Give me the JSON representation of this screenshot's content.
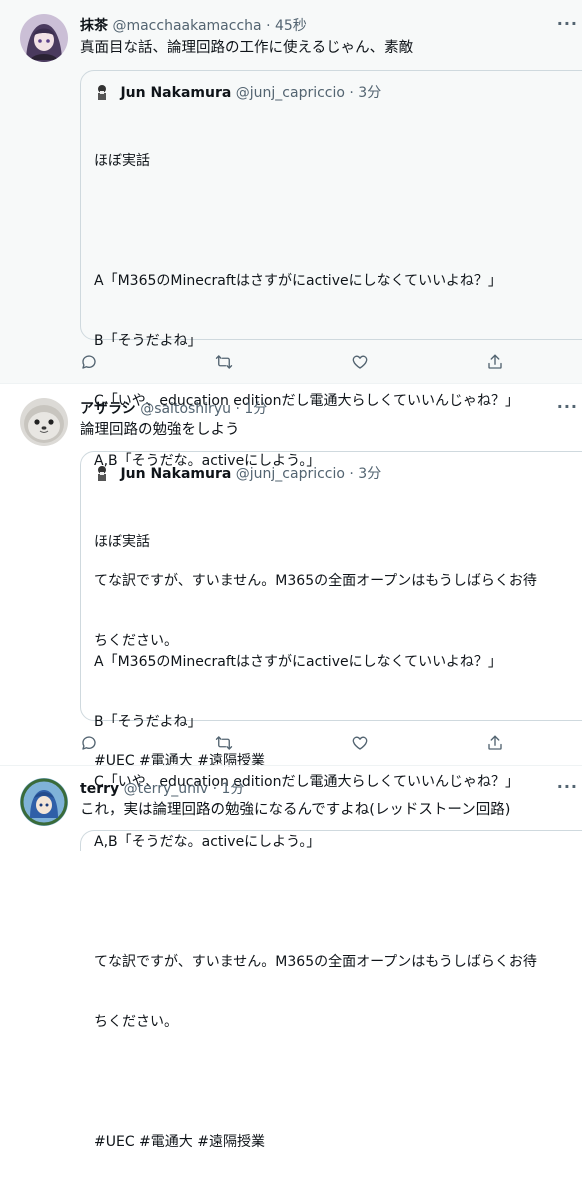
{
  "quoted": {
    "name": "Jun Nakamura",
    "handle": "@junj_capriccio",
    "time": "· 3分",
    "lines": [
      "ほぼ実話",
      "",
      "A「M365のMinecraftはさすがにactiveにしなくていいよね？」",
      "B「そうだよね」",
      "C「いや、education editionだし電通大らしくていいんじゃね？」",
      "A,B「そうだな。activeにしよう。」",
      "",
      "てな訳ですが、すいません。M365の全面オープンはもうしばらくお待",
      "ちください。",
      "",
      "#UEC #電通大 #遠隔授業"
    ]
  },
  "tweets": [
    {
      "name": "抹茶",
      "handle": "@macchaakamaccha",
      "time": "· 45秒",
      "text": "真面目な話、論理回路の工作に使えるじゃん、素敵"
    },
    {
      "name": "アザラシ",
      "handle": "@saitoshiryu",
      "time": "· 1分",
      "text": "論理回路の勉強をしよう"
    },
    {
      "name": "terry",
      "handle": "@terry_univ",
      "time": "· 1分",
      "text": "これ，実は論理回路の勉強になるんですよね(レッドストーン回路)"
    }
  ],
  "icons": {
    "more": "more-horizontal-icon",
    "reply": "reply-icon",
    "retweet": "retweet-icon",
    "like": "like-icon",
    "share": "share-icon"
  },
  "more_glyph": "···"
}
